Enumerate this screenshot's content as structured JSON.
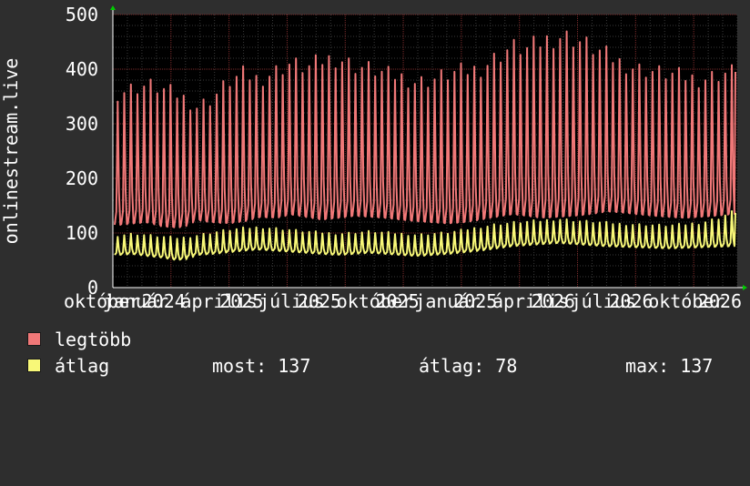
{
  "chart_data": {
    "type": "line",
    "ylabel": "onlinestream.live",
    "ylim": [
      0,
      500
    ],
    "yticks": [
      0,
      100,
      200,
      300,
      400,
      500
    ],
    "xlabels": [
      "október",
      "január",
      "2024",
      "április",
      "2025",
      "július",
      "2025",
      "október",
      "2025",
      "január",
      "2025",
      "április",
      "2026",
      "július",
      "2026",
      "október",
      "2026"
    ],
    "x": [
      "2023-10-01",
      "2026-10-31"
    ],
    "grid": true,
    "legend_position": "bottom-left",
    "series": [
      {
        "name": "legtöbb",
        "color": "#f07878",
        "values_low": [
          115,
          118,
          120,
          112,
          110,
          125,
          120,
          118,
          122,
          130,
          128,
          135,
          130,
          125,
          128,
          132,
          130,
          128,
          125,
          122,
          120,
          118,
          120,
          125,
          130,
          135,
          132,
          128,
          130,
          132,
          135,
          140,
          138,
          135,
          132,
          130,
          128,
          130,
          132,
          135
        ],
        "values_peak": [
          355,
          365,
          370,
          360,
          350,
          330,
          345,
          375,
          390,
          380,
          395,
          410,
          400,
          415,
          420,
          405,
          400,
          390,
          385,
          375,
          380,
          390,
          395,
          400,
          420,
          440,
          435,
          450,
          460,
          455,
          440,
          425,
          410,
          400,
          395,
          390,
          385,
          380,
          388,
          395
        ]
      },
      {
        "name": "átlag",
        "color": "#f8f878",
        "values_low": [
          60,
          62,
          58,
          55,
          50,
          60,
          62,
          65,
          68,
          70,
          68,
          66,
          64,
          62,
          60,
          62,
          64,
          62,
          60,
          58,
          60,
          62,
          65,
          68,
          72,
          76,
          78,
          80,
          82,
          80,
          78,
          76,
          75,
          74,
          73,
          72,
          73,
          74,
          75,
          76
        ],
        "values_peak": [
          95,
          98,
          95,
          92,
          90,
          95,
          100,
          105,
          108,
          110,
          108,
          105,
          102,
          100,
          98,
          100,
          102,
          100,
          98,
          96,
          98,
          100,
          105,
          110,
          115,
          118,
          120,
          122,
          125,
          122,
          120,
          118,
          116,
          115,
          114,
          113,
          115,
          118,
          125,
          137
        ]
      }
    ]
  },
  "legend": {
    "max_label": "legtöbb",
    "avg_label": "átlag",
    "now_label": "most: 137",
    "avg_value_label": "átlag: 78",
    "max_value_label": "max: 137"
  },
  "colors": {
    "background": "#2e2e2e",
    "canvas": "#000000",
    "grid_major": "#7a2a2a",
    "grid_minor": "#3a3a3a",
    "axis": "#ffffff",
    "arrow": "#00cc00"
  }
}
